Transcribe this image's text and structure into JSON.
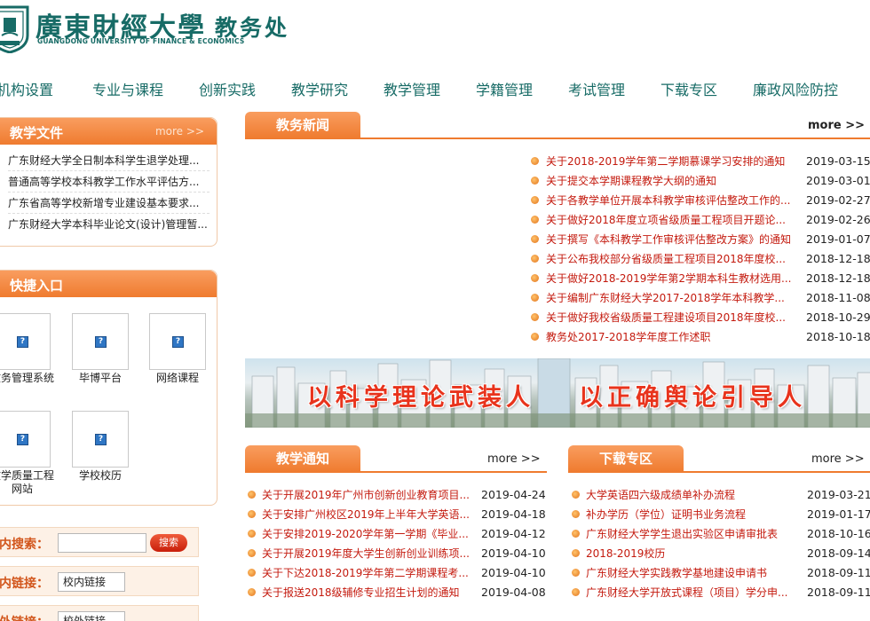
{
  "brand": {
    "name_cn": "廣東財經大學",
    "name_en": "GUANGDONG UNIVERSITY OF FINANCE & ECONOMICS",
    "dept": "教务处",
    "color": "#176b66"
  },
  "nav": {
    "items": [
      "机构设置",
      "专业与课程",
      "创新实践",
      "教学研究",
      "教学管理",
      "学籍管理",
      "考试管理",
      "下载专区",
      "廉政风险防控"
    ]
  },
  "teaching_docs": {
    "title": "教学文件",
    "more": "more >>",
    "items": [
      "广东财经大学全日制本科学生退学处理...",
      "普通高等学校本科教学工作水平评估方...",
      "广东省高等学校新增专业建设基本要求...",
      "广东财经大学本科毕业论文(设计)管理暂..."
    ]
  },
  "quick_entry": {
    "title": "快捷入口",
    "items": [
      {
        "label": "教务管理系统",
        "icon": "broken-image-icon"
      },
      {
        "label": "毕博平台",
        "icon": "broken-image-icon"
      },
      {
        "label": "网络课程",
        "icon": "broken-image-icon"
      },
      {
        "label": "教学质量工程网站",
        "icon": "broken-image-icon"
      },
      {
        "label": "学校校历",
        "icon": "broken-image-icon"
      }
    ]
  },
  "site_search": {
    "label": "内搜索：",
    "value": "",
    "button": "搜索"
  },
  "links": {
    "internal_label": "内链接：",
    "internal_value": "校内链接",
    "external_label": "外链接：",
    "external_value": "校外链接"
  },
  "news": {
    "title": "教务新闻",
    "more": "more >>",
    "items": [
      {
        "title": "关于2018-2019学年第二学期慕课学习安排的通知",
        "date": "2019-03-15"
      },
      {
        "title": "关于提交本学期课程教学大纲的通知",
        "date": "2019-03-01"
      },
      {
        "title": "关于各教学单位开展本科教学审核评估整改工作的...",
        "date": "2019-02-27"
      },
      {
        "title": "关于做好2018年度立项省级质量工程项目开题论...",
        "date": "2019-02-26"
      },
      {
        "title": "关于撰写《本科教学工作审核评估整改方案》的通知",
        "date": "2019-01-07"
      },
      {
        "title": "关于公布我校部分省级质量工程项目2018年度校...",
        "date": "2018-12-18"
      },
      {
        "title": "关于做好2018-2019学年第2学期本科生教材选用...",
        "date": "2018-12-18"
      },
      {
        "title": "关于编制广东财经大学2017-2018学年本科教学...",
        "date": "2018-11-08"
      },
      {
        "title": "关于做好我校省级质量工程建设项目2018年度校...",
        "date": "2018-10-29"
      },
      {
        "title": "教务处2017-2018学年度工作述职",
        "date": "2018-10-18"
      }
    ]
  },
  "banner": {
    "left": "以科学理论武装人",
    "right": "以正确舆论引导人"
  },
  "notices": {
    "title": "教学通知",
    "more": "more >>",
    "items": [
      {
        "title": "关于开展2019年广州市创新创业教育项目...",
        "date": "2019-04-24"
      },
      {
        "title": "关于安排广州校区2019年上半年大学英语...",
        "date": "2019-04-18"
      },
      {
        "title": "关于安排2019-2020学年第一学期《毕业...",
        "date": "2019-04-12"
      },
      {
        "title": "关于开展2019年度大学生创新创业训练项...",
        "date": "2019-04-10"
      },
      {
        "title": "关于下达2018-2019学年第二学期课程考...",
        "date": "2019-04-10"
      },
      {
        "title": "关于报送2018级辅修专业招生计划的通知",
        "date": "2019-04-08"
      }
    ]
  },
  "downloads": {
    "title": "下载专区",
    "more": "more >>",
    "items": [
      {
        "title": "大学英语四六级成绩单补办流程",
        "date": "2019-03-21"
      },
      {
        "title": "补办学历（学位）证明书业务流程",
        "date": "2019-01-17"
      },
      {
        "title": "广东财经大学学生退出实验区申请审批表",
        "date": "2018-10-16"
      },
      {
        "title": "2018-2019校历",
        "date": "2018-09-14"
      },
      {
        "title": "广东财经大学实践教学基地建设申请书",
        "date": "2018-09-11"
      },
      {
        "title": "广东财经大学开放式课程（项目）学分申...",
        "date": "2018-09-11"
      }
    ]
  },
  "colors": {
    "accent_orange": "#ef7b2f",
    "link_red": "#c41a0e",
    "brand_teal": "#176b66"
  }
}
